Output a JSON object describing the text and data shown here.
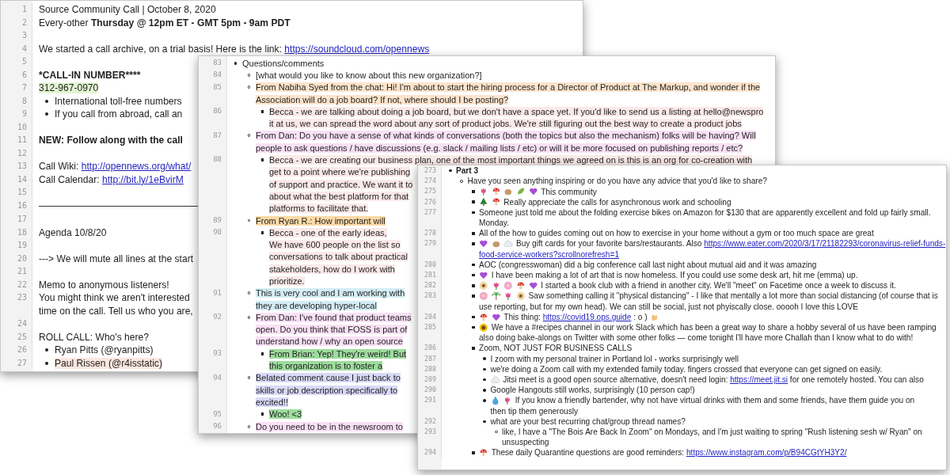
{
  "windows": [
    {
      "lines": [
        {
          "num": "1",
          "rows": [
            {
              "text": "Source Community Call | October 8, 2020"
            }
          ]
        },
        {
          "num": "2",
          "rows": [
            {
              "text": "Every-other **Thursday @ 12pm ET - GMT 5pm - 9am PDT**"
            }
          ]
        },
        {
          "num": "3"
        },
        {
          "num": "4",
          "rows": [
            {
              "text": "We started a call archive, on a trial basis! Here is the link: ",
              "link": "https://soundcloud.com/opennews"
            }
          ]
        },
        {
          "num": "5"
        },
        {
          "num": "6",
          "bold": true,
          "rows": [
            {
              "text": "*****CALL-IN NUMBER****"
            }
          ]
        },
        {
          "num": "7",
          "color": "#e3f6d3",
          "rows": [
            {
              "text": "312-967-0970"
            }
          ],
          "children": [
            {
              "num": "8",
              "rows": [
                {
                  "text": "International toll-free numbers"
                }
              ]
            },
            {
              "num": "9",
              "rows": [
                {
                  "text": "If you call from abroad, call an"
                }
              ]
            }
          ]
        },
        {
          "num": "10"
        },
        {
          "num": "11",
          "bold": true,
          "rows": [
            {
              "text": "NEW: Follow along with the call"
            }
          ]
        },
        {
          "num": "12"
        },
        {
          "num": "13",
          "rows": [
            {
              "text": "Call Wiki: ",
              "link": "http://opennews.org/what/"
            }
          ]
        },
        {
          "num": "14",
          "rows": [
            {
              "text": "Call Calendar: ",
              "link": "http://bit.ly/1eBvirM"
            }
          ]
        },
        {
          "num": "15"
        },
        {
          "num": "16",
          "rule": true
        },
        {
          "num": "17"
        },
        {
          "num": "18",
          "rows": [
            {
              "text": "Agenda 10/8/20"
            }
          ]
        },
        {
          "num": "19"
        },
        {
          "num": "20",
          "rows": [
            {
              "text": "---> We will mute all lines at the start"
            }
          ]
        },
        {
          "num": "21"
        },
        {
          "num": "22",
          "rows": [
            {
              "text": "Memo to anonymous listeners!"
            }
          ]
        },
        {
          "num": "23",
          "rows": [
            {
              "text": "You might think we aren't interested"
            },
            {
              "text": "time on the call. Tell us who you are,"
            }
          ]
        },
        {
          "num": "24"
        },
        {
          "num": "25",
          "rows": [
            {
              "text": "ROLL CALL: Who's here?"
            }
          ],
          "children": [
            {
              "num": "26",
              "rows": [
                {
                  "text": "Ryan Pitts (@ryanpitts)"
                }
              ]
            },
            {
              "num": "27",
              "color": "#fbe7df",
              "rows": [
                {
                  "text": "Paul Rissen (@r4isstatic)"
                }
              ]
            }
          ]
        }
      ]
    },
    {
      "bulleted": true,
      "lines": [
        {
          "num": "83",
          "rows": [
            {
              "text": "Questions/comments"
            }
          ],
          "children": [
            {
              "num": "84",
              "rows": [
                {
                  "text": "[what would you like to know about this new organization?]"
                }
              ]
            },
            {
              "num": "85",
              "color": "#fde4cc",
              "rows": [
                {
                  "text": "From Nabiha Syed from the chat: Hi! I'm about to start the hiring process for a Director of Product at The Markup, and wonder if the"
                },
                {
                  "text": "Association will do a job board? If not, where should I be posting?"
                }
              ],
              "children": [
                {
                  "num": "86",
                  "color": "#fbe9e9",
                  "rows": [
                    {
                      "text": "Becca - we are talking about doing a job board, but we don't have a space yet. If you'd like to send us a listing at hello@newspro"
                    },
                    {
                      "text": "it at us, we can spread the word about any sort of product jobs. We're still figuring out the best way to create a product jobs"
                    }
                  ]
                }
              ]
            },
            {
              "num": "87",
              "color": "#f9e0f5",
              "rows": [
                {
                  "text": "From Dan: Do you have a sense of what kinds of conversations (both the topics but also the mechanism) folks will be having? Will"
                },
                {
                  "text": "people to ask questions / have discussions (e.g. slack / mailing lists / etc) or will it be more focused on publishing reports / etc?"
                }
              ],
              "children": [
                {
                  "num": "88",
                  "color": "#fbe9e9",
                  "rows": [
                    {
                      "text": "Becca - we are creating our business plan, one of the most important things we agreed on is this is an org for co-creation with"
                    },
                    {
                      "text": "get to a point where we're publishing"
                    },
                    {
                      "text": "of support and practice. We want it to"
                    },
                    {
                      "text": "about what the best platform for that"
                    },
                    {
                      "text": "platforms to facilitate that."
                    }
                  ]
                }
              ]
            },
            {
              "num": "89",
              "color": "#fcd9a6",
              "rows": [
                {
                  "text": "From Ryan R.: How important will"
                }
              ],
              "children": [
                {
                  "num": "90",
                  "color": "#fbe9e9",
                  "rows": [
                    {
                      "text": "Becca - one of the early ideas,"
                    },
                    {
                      "text": "We have 600 people on the list so"
                    },
                    {
                      "text": "conversations to talk about practical"
                    },
                    {
                      "text": "stakeholders, how do I work with"
                    },
                    {
                      "text": "prioritize."
                    }
                  ]
                }
              ]
            },
            {
              "num": "91",
              "color": "#d5edf5",
              "rows": [
                {
                  "text": "This is very cool and I am working with"
                },
                {
                  "text": "they are developing hyper-local"
                }
              ]
            },
            {
              "num": "92",
              "color": "#f9e0f5",
              "rows": [
                {
                  "text": "From Dan: I've found that product teams"
                },
                {
                  "text": "open. Do you think that FOSS is part of"
                },
                {
                  "text": "understand how / why an open source"
                }
              ],
              "children": [
                {
                  "num": "93",
                  "color": "#9edc9e",
                  "rows": [
                    {
                      "text": "From Brian: Yep! They're weird! But"
                    },
                    {
                      "text": "this organization is to foster a"
                    }
                  ]
                }
              ]
            },
            {
              "num": "94",
              "color": "#d9d9f7",
              "rows": [
                {
                  "text": "Belated comment cause I just back to"
                },
                {
                  "text": "skills or job description specifically to"
                },
                {
                  "text": "excited!!"
                }
              ],
              "children": [
                {
                  "num": "95",
                  "color": "#9edc9e",
                  "rows": [
                    {
                      "text": "Woo! <3"
                    }
                  ]
                }
              ]
            },
            {
              "num": "96",
              "color": "#f9e0f5",
              "rows": [
                {
                  "text": "Do you need to be in the newsroom to"
                }
              ]
            }
          ]
        }
      ]
    },
    {
      "bulleted": true,
      "lines": [
        {
          "num": "273",
          "bold": true,
          "rows": [
            {
              "text": "Part 3"
            }
          ],
          "children": [
            {
              "num": "274",
              "rows": [
                {
                  "text": "Have you seen anything inspiring or do you have any advice that you'd like to share?"
                }
              ],
              "children": [
                {
                  "num": "275",
                  "rows": [
                    {
                      "icons": [
                        {
                          "kind": "tulip"
                        },
                        {
                          "kind": "mushroom"
                        },
                        {
                          "kind": "nut"
                        },
                        {
                          "kind": "leaf"
                        },
                        {
                          "kind": "heart"
                        }
                      ],
                      "text": "This community"
                    }
                  ]
                },
                {
                  "num": "276",
                  "rows": [
                    {
                      "icons": [
                        {
                          "kind": "tree"
                        },
                        {
                          "kind": "mushroom"
                        }
                      ],
                      "text": "Really appreciate the calls for asynchronous work and schooling"
                    }
                  ]
                },
                {
                  "num": "277",
                  "rows": [
                    {
                      "text": "Someone just told me about the folding exercise bikes on Amazon for $130 that are apparently excellent and fold up fairly small."
                    },
                    {
                      "text": "Monday."
                    }
                  ]
                },
                {
                  "num": "278",
                  "rows": [
                    {
                      "text": "All of the how to guides coming out on how to exercise in your home without a gym or too much space are great"
                    }
                  ]
                },
                {
                  "num": "279",
                  "rows": [
                    {
                      "icons": [
                        {
                          "kind": "heart"
                        },
                        {
                          "kind": "nut"
                        },
                        {
                          "kind": "cloud"
                        }
                      ],
                      "text": "Buy gift cards for your favorite bars/restaurants. Also ",
                      "link": "https://www.eater.com/2020/3/17/21182293/coronavirus-relief-funds-"
                    },
                    {
                      "link": "food-service-workers?scrollnorefresh=1"
                    }
                  ]
                },
                {
                  "num": "280",
                  "rows": [
                    {
                      "text": "AOC (congresswoman) did a big conference call last night about mutual aid and it was amazing"
                    }
                  ]
                },
                {
                  "num": "281",
                  "rows": [
                    {
                      "icons": [
                        {
                          "kind": "heart"
                        }
                      ],
                      "text": "I have been making a lot of art that is now homeless. If you could use some desk art, hit me  (emma) up."
                    }
                  ]
                },
                {
                  "num": "282",
                  "rows": [
                    {
                      "icons": [
                        {
                          "kind": "daisy"
                        },
                        {
                          "kind": "tulip"
                        },
                        {
                          "kind": "flower"
                        },
                        {
                          "kind": "mushroom"
                        },
                        {
                          "kind": "heart"
                        }
                      ],
                      "text": "I started a book club with a friend in another city. We'll \"meet\" on Facetime once a week to discuss it."
                    }
                  ]
                },
                {
                  "num": "283",
                  "rows": [
                    {
                      "icons": [
                        {
                          "kind": "flower"
                        },
                        {
                          "kind": "palm"
                        },
                        {
                          "kind": "tulip"
                        },
                        {
                          "kind": "daisy"
                        }
                      ],
                      "text": "Saw something calling it \"physical distancing\" - I like that mentally a lot more than social distancing (of course that is"
                    },
                    {
                      "text": "use reporting, but for my own head). We can still be social, just not phyiscally close. ooooh I love this LOVE"
                    }
                  ]
                },
                {
                  "num": "284",
                  "rows": [
                    {
                      "icons": [
                        {
                          "kind": "mushroom"
                        },
                        {
                          "kind": "heart"
                        }
                      ],
                      "text": "This thing: ",
                      "link": "https://covid19.ops.guide",
                      "after": " : o )",
                      "icons_after": [
                        {
                          "kind": "hands"
                        }
                      ]
                    }
                  ]
                },
                {
                  "num": "285",
                  "rows": [
                    {
                      "icons": [
                        {
                          "kind": "sunflower"
                        }
                      ],
                      "text": "We have a #recipes channel in our work Slack which has been a great way to share a hobby several of us have been ramping"
                    },
                    {
                      "text": "also doing bake-alongs on Twitter with some other folks — come tonight I'll have more Challah than I know what to do with!"
                    }
                  ]
                },
                {
                  "num": "286",
                  "rows": [
                    {
                      "text": "Zoom, NOT JUST FOR BUSINESS CALLS"
                    }
                  ],
                  "children": [
                    {
                      "num": "287",
                      "rows": [
                        {
                          "text": "I zoom with my personal trainer in Portland lol - works surprisingly well"
                        }
                      ]
                    },
                    {
                      "num": "288",
                      "rows": [
                        {
                          "text": "we're doing a Zoom call with my extended family today. fingers crossed that everyone can get signed on easily."
                        }
                      ]
                    },
                    {
                      "num": "289",
                      "rows": [
                        {
                          "icons": [
                            {
                              "kind": "cloud"
                            }
                          ],
                          "text": "Jitsi meet is a good open source alternative, doesn't need login: ",
                          "link": "https://meet.jit.si",
                          "after": " for one remotely hosted. You can also"
                        }
                      ]
                    },
                    {
                      "num": "290",
                      "rows": [
                        {
                          "text": "Google Hangouts still works, surprisingly  (10 person cap!)"
                        }
                      ]
                    },
                    {
                      "num": "291",
                      "rows": [
                        {
                          "icons": [
                            {
                              "kind": "drop"
                            },
                            {
                              "kind": "tulip"
                            }
                          ],
                          "text": "If you know a friendly bartender, why not have virtual drinks with them and some friends, have them guide you on"
                        },
                        {
                          "text": "then tip them generously"
                        }
                      ]
                    },
                    {
                      "num": "292",
                      "rows": [
                        {
                          "text": "what are your best recurring chat/group thread names?"
                        }
                      ],
                      "children": [
                        {
                          "num": "293",
                          "rows": [
                            {
                              "text": "like, I have a \"The Bois Are Back In Zoom\" on Mondays, and I'm just waiting to spring \"Rush listening sesh w/ Ryan\" on"
                            },
                            {
                              "text": "unsuspecting"
                            }
                          ]
                        }
                      ]
                    }
                  ]
                },
                {
                  "num": "294",
                  "rows": [
                    {
                      "icons": [
                        {
                          "kind": "mushroom"
                        }
                      ],
                      "text": "These daily Quarantine questions are good reminders: ",
                      "link": "https://www.instagram.com/p/B94CGtYH3Y2/"
                    }
                  ]
                }
              ]
            }
          ]
        }
      ]
    }
  ]
}
